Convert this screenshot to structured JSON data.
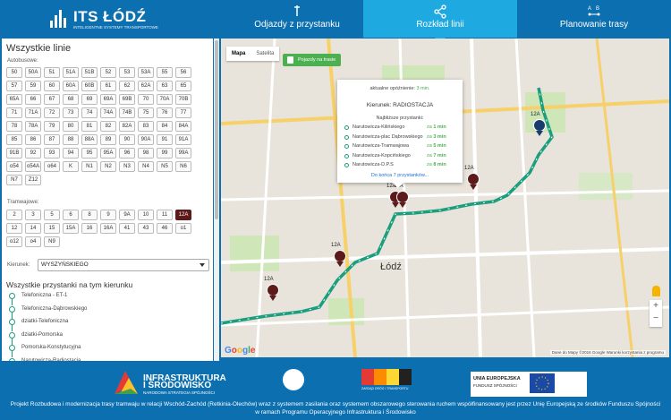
{
  "header": {
    "brand": "ITS ŁÓDŹ",
    "tagline": "INTELIGENTNE SYSTEMY TRANSPORTOWE",
    "tabs": [
      {
        "label": "Odjazdy z przystanku",
        "icon": "bus-stop-icon",
        "active": false
      },
      {
        "label": "Rozkład linii",
        "icon": "share-icon",
        "active": true
      },
      {
        "label": "Planowanie trasy",
        "icon": "route-icon",
        "active": false
      }
    ]
  },
  "panel": {
    "title": "Wszystkie linie",
    "bus_label": "Autobusowe:",
    "bus_lines": [
      "50",
      "50A",
      "51",
      "51A",
      "51B",
      "52",
      "53",
      "53A",
      "55",
      "56",
      "57",
      "59",
      "60",
      "60A",
      "60B",
      "61",
      "62",
      "62A",
      "63",
      "65",
      "65A",
      "66",
      "67",
      "68",
      "69",
      "69A",
      "69B",
      "70",
      "70A",
      "70B",
      "71",
      "71A",
      "72",
      "73",
      "74",
      "74A",
      "74B",
      "75",
      "76",
      "77",
      "78",
      "78A",
      "79",
      "80",
      "81",
      "82",
      "82A",
      "83",
      "84",
      "84A",
      "85",
      "86",
      "87",
      "88",
      "88A",
      "89",
      "90",
      "90A",
      "91",
      "91A",
      "91B",
      "92",
      "93",
      "94",
      "95",
      "95A",
      "96",
      "98",
      "99",
      "99A",
      "o54",
      "o54A",
      "o64",
      "K",
      "N1",
      "N2",
      "N3",
      "N4",
      "N5",
      "N6",
      "N7",
      "Z12"
    ],
    "tram_label": "Tramwajowe:",
    "tram_lines": [
      "2",
      "3",
      "5",
      "6",
      "8",
      "9",
      "9A",
      "10",
      "11",
      "12A",
      "12",
      "14",
      "15",
      "15A",
      "16",
      "16A",
      "41",
      "43",
      "46",
      "o1",
      "o12",
      "o4",
      "N9"
    ],
    "selected_line": "12A",
    "direction_label": "Kierunek:",
    "direction_value": "WYSZYŃSKIEGO",
    "stops_title": "Wszystkie przystanki na tym kierunku",
    "stops": [
      "Telefoniczna - ET-1",
      "Telefoniczna-Dąbrowskiego",
      "dziatki-Telefoniczna",
      "dziatki-Pomorska",
      "Pomorska-Konstytucyjna",
      "Narutowicza-Radiostacja"
    ]
  },
  "map": {
    "type_buttons": [
      "Mapa",
      "Satelita"
    ],
    "vehicles_button": "Pojazdy na trasie",
    "popup": {
      "delay_prefix": "aktualne opóźnienie:",
      "delay_value": "3 min.",
      "driver_prefix": "Kierunek:",
      "driver_value": "RADIOSTACJA",
      "nearest_label": "Najbliższe przystanki:",
      "in_label": "za",
      "stops": [
        {
          "name": "Narutowicza-Kilińskiego",
          "in": "1 min"
        },
        {
          "name": "Narutowicza-plac Dąbrowskiego",
          "in": "3 min"
        },
        {
          "name": "Narutowicza-Tramwajowa",
          "in": "5 min"
        },
        {
          "name": "Narutowicza-Kopcińskiego",
          "in": "7 min"
        },
        {
          "name": "Narutowicza-D.P.S",
          "in": "8 min"
        }
      ],
      "more_link": "Do końca 7 przystanków..."
    },
    "city_label": "Łódź",
    "markers": [
      "12A",
      "12A",
      "12A",
      "12A",
      "12A",
      "12A"
    ],
    "google": "Google",
    "footer_text": "Dane do Mapy ©2016 Google   Warunki korzystania z programu"
  },
  "footer": {
    "infra_title_1": "INFRASTRUKTURA",
    "infra_title_2": "I ŚRODOWISKO",
    "infra_sub": "NARODOWA STRATEGIA SPÓJNOŚCI",
    "zdit": "ZARZĄD DRÓG I TRANSPORTU",
    "ue_1": "UNIA EUROPEJSKA",
    "ue_2": "FUNDUSZ SPÓJNOŚCI",
    "note": "Projekt Rozbudowa i modernizacja trasy tramwaju w relacji Wschód-Zachód (Retkinia-Olechów) wraz z systemem zasilania oraz systemem obszarowego sterowania ruchem współfinansowany jest przez Unię Europejską ze środków Funduszu Spójności w ramach Programu Operacyjnego Infrastruktura i Środowisko"
  },
  "colors": {
    "brand": "#0b6fb0",
    "accent": "#1ea9e1",
    "route": "#1a9e7e",
    "selected": "#5c1a1a",
    "delay": "#4caf50"
  }
}
